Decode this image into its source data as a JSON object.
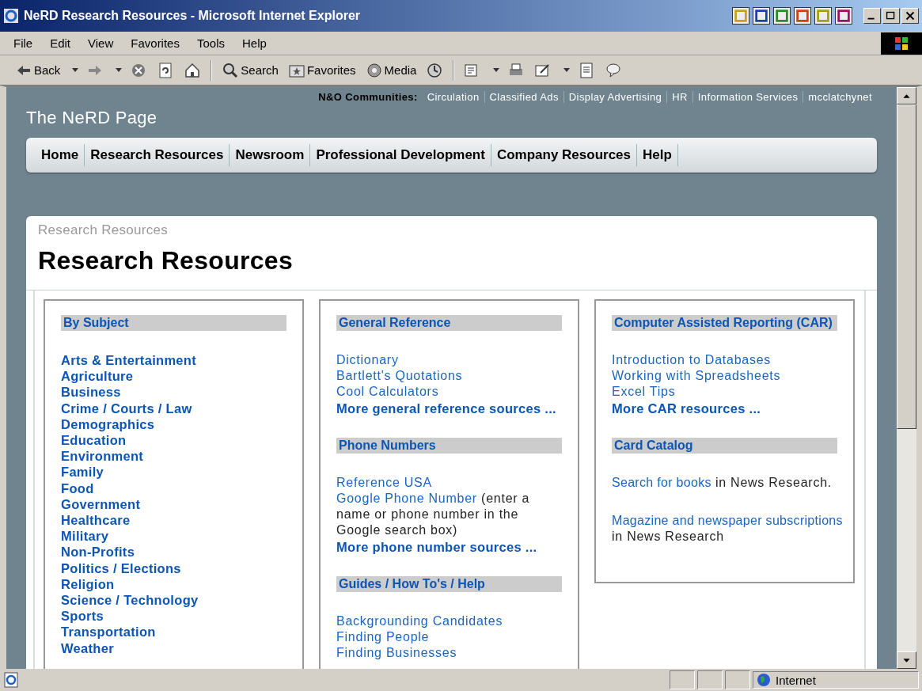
{
  "window": {
    "title": "NeRD Research Resources - Microsoft Internet Explorer"
  },
  "menu": [
    "File",
    "Edit",
    "View",
    "Favorites",
    "Tools",
    "Help"
  ],
  "toolbar": [
    {
      "kind": "back",
      "label": "Back",
      "dropdown": true
    },
    {
      "kind": "forward",
      "dropdown": true
    },
    {
      "kind": "stop"
    },
    {
      "kind": "refresh"
    },
    {
      "kind": "home"
    },
    {
      "kind": "separator"
    },
    {
      "kind": "search",
      "label": "Search"
    },
    {
      "kind": "favorites",
      "label": "Favorites"
    },
    {
      "kind": "media",
      "label": "Media"
    },
    {
      "kind": "history"
    },
    {
      "kind": "separator"
    },
    {
      "kind": "mail",
      "dropdown": true
    },
    {
      "kind": "print"
    },
    {
      "kind": "edit",
      "dropdown": true
    },
    {
      "kind": "page"
    },
    {
      "kind": "discuss"
    }
  ],
  "page": {
    "communities": {
      "label": "N&O Communities:",
      "links": [
        "Circulation",
        "Classified Ads",
        "Display Advertising",
        "HR",
        "Information Services",
        "mcclatchynet"
      ]
    },
    "site_title": "The NeRD Page",
    "nav": [
      "Home",
      "Research Resources",
      "Newsroom",
      "Professional Development",
      "Company Resources",
      "Help"
    ],
    "breadcrumb": "Research Resources",
    "heading": "Research Resources",
    "columns": [
      {
        "sections": [
          {
            "title": "By Subject",
            "items": [
              {
                "kind": "subject",
                "text": "Arts & Entertainment"
              },
              {
                "kind": "subject",
                "text": "Agriculture"
              },
              {
                "kind": "subject",
                "text": "Business"
              },
              {
                "kind": "subject",
                "text": "Crime / Courts / Law"
              },
              {
                "kind": "subject",
                "text": "Demographics"
              },
              {
                "kind": "subject",
                "text": "Education"
              },
              {
                "kind": "subject",
                "text": "Environment"
              },
              {
                "kind": "subject",
                "text": "Family"
              },
              {
                "kind": "subject",
                "text": "Food"
              },
              {
                "kind": "subject",
                "text": "Government"
              },
              {
                "kind": "subject",
                "text": "Healthcare"
              },
              {
                "kind": "subject",
                "text": "Military"
              },
              {
                "kind": "subject",
                "text": "Non-Profits"
              },
              {
                "kind": "subject",
                "text": "Politics / Elections"
              },
              {
                "kind": "subject",
                "text": "Religion"
              },
              {
                "kind": "subject",
                "text": "Science / Technology"
              },
              {
                "kind": "subject",
                "text": "Sports"
              },
              {
                "kind": "subject",
                "text": "Transportation"
              },
              {
                "kind": "subject",
                "text": "Weather"
              }
            ]
          }
        ]
      },
      {
        "sections": [
          {
            "title": "General Reference",
            "items": [
              {
                "kind": "link",
                "text": "Dictionary"
              },
              {
                "kind": "link",
                "text": "Bartlett's Quotations"
              },
              {
                "kind": "link",
                "text": "Cool Calculators"
              },
              {
                "kind": "more",
                "text": "More general reference sources ..."
              }
            ]
          },
          {
            "title": "Phone Numbers",
            "items": [
              {
                "kind": "link",
                "text": "Reference USA"
              },
              {
                "kind": "note",
                "text": "Google Phone Number",
                "note": "(enter a name or phone number in the Google search box)"
              },
              {
                "kind": "more",
                "text": "More phone number sources ..."
              }
            ]
          },
          {
            "title": "Guides / How To's / Help",
            "items": [
              {
                "kind": "link",
                "text": "Backgrounding Candidates"
              },
              {
                "kind": "link",
                "text": "Finding People"
              },
              {
                "kind": "link",
                "text": "Finding Businesses"
              }
            ]
          }
        ]
      },
      {
        "sections": [
          {
            "title": "Computer Assisted Reporting (CAR)",
            "items": [
              {
                "kind": "link",
                "text": "Introduction to Databases"
              },
              {
                "kind": "link",
                "text": "Working with Spreadsheets"
              },
              {
                "kind": "link",
                "text": "Excel Tips"
              },
              {
                "kind": "more",
                "text": "More CAR resources ..."
              }
            ]
          },
          {
            "title": "Card Catalog",
            "items": [
              {
                "kind": "note",
                "text": "Search for books",
                "note": "in News Research."
              },
              {
                "kind": "spacer"
              },
              {
                "kind": "note",
                "text": "Magazine and newspaper subscriptions",
                "note": "in News Research"
              }
            ]
          }
        ]
      }
    ]
  },
  "status_bar": {
    "zone": "Internet"
  }
}
